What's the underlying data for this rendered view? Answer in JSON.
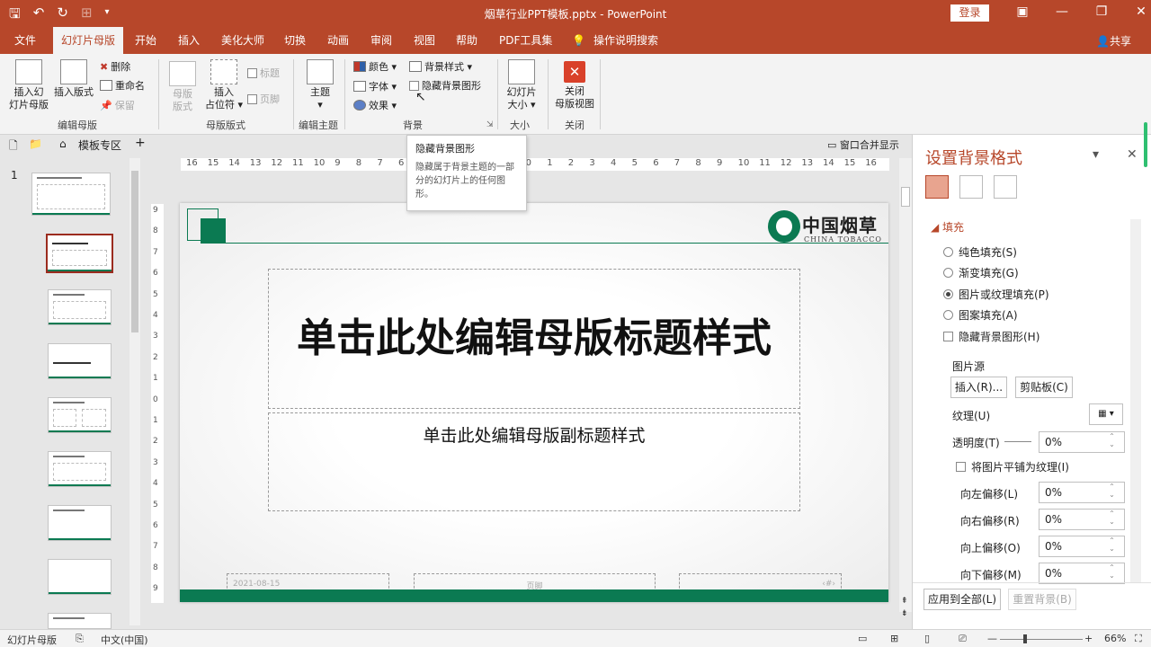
{
  "titlebar": {
    "title": "烟草行业PPT模板.pptx  -  PowerPoint",
    "login_label": "登录",
    "qat": {
      "save": "🖫",
      "undo": "↶",
      "redo": "↻",
      "touch": "⊞",
      "more": "▾"
    },
    "window": {
      "ribbon_opts": "▣",
      "minimize": "—",
      "restore": "❐",
      "close": "✕"
    }
  },
  "tabs": [
    "文件",
    "幻灯片母版",
    "开始",
    "插入",
    "美化大师",
    "切换",
    "动画",
    "审阅",
    "视图",
    "帮助",
    "PDF工具集",
    "操作说明搜索"
  ],
  "tab_share": "共享",
  "ribbon": {
    "insert_master": "插入幻\n灯片母版",
    "insert_layout": "插入版式",
    "delete": "删除",
    "rename": "重命名",
    "preserve": "保留",
    "group_edit_master": "编辑母版",
    "master_layout": "母版\n版式",
    "insert_placeholder": "插入\n占位符 ▾",
    "title_chk": "标题",
    "footer_chk": "页脚",
    "group_master_layout": "母版版式",
    "theme": "主题\n▾",
    "group_edit_theme": "编辑主题",
    "colors": "颜色 ▾",
    "fonts": "字体 ▾",
    "effects": "效果 ▾",
    "bg_styles": "背景样式 ▾",
    "hide_bg": "隐藏背景图形",
    "group_background": "背景",
    "slide_size": "幻灯片\n大小 ▾",
    "group_size": "大小",
    "close_master": "关闭\n母版视图",
    "group_close": "关闭"
  },
  "tooltip": {
    "title": "隐藏背景图形",
    "body": "隐藏属于背景主题的一部分的幻灯片上的任何图形。"
  },
  "navbar": {
    "template_area": "模板专区",
    "add": "+",
    "merge_windows": "窗口合并显示"
  },
  "thumbs": {
    "slide_number": "1"
  },
  "ruler": {
    "h": [
      "16",
      "15",
      "14",
      "13",
      "12",
      "11",
      "10",
      "9",
      "8",
      "7",
      "6",
      "5",
      "4",
      "3",
      "2",
      "1",
      "0",
      "1",
      "2",
      "3",
      "4",
      "5",
      "6",
      "7",
      "8",
      "9",
      "10",
      "11",
      "12",
      "13",
      "14",
      "15",
      "16"
    ],
    "v": [
      "9",
      "8",
      "7",
      "6",
      "5",
      "4",
      "3",
      "2",
      "1",
      "0",
      "1",
      "2",
      "3",
      "4",
      "5",
      "6",
      "7",
      "8",
      "9"
    ]
  },
  "slide": {
    "logo_cn": "中国烟草",
    "logo_en": "CHINA TOBACCO",
    "title": "单击此处编辑母版标题样式",
    "subtitle": "单击此处编辑母版副标题样式",
    "footer_date": "2021-08-15",
    "footer_text": "页脚",
    "footer_num": "‹#›"
  },
  "pane": {
    "title": "设置背景格式",
    "dropdown": "▾",
    "close": "✕",
    "section_fill": "◢ 填充",
    "fill_solid": "纯色填充(S)",
    "fill_gradient": "渐变填充(G)",
    "fill_picture": "图片或纹理填充(P)",
    "fill_pattern": "图案填充(A)",
    "hide_bg": "隐藏背景图形(H)",
    "picture_source": "图片源",
    "insert_btn": "插入(R)...",
    "clipboard_btn": "剪贴板(C)",
    "texture": "纹理(U)",
    "transparency": "透明度(T)",
    "transparency_val": "0%",
    "tile": "将图片平铺为纹理(I)",
    "offset_left": "向左偏移(L)",
    "offset_left_val": "0%",
    "offset_right": "向右偏移(R)",
    "offset_right_val": "0%",
    "offset_top": "向上偏移(O)",
    "offset_top_val": "0%",
    "offset_bottom": "向下偏移(M)",
    "offset_bottom_val": "0%",
    "apply_all": "应用到全部(L)",
    "reset_bg": "重置背景(B)"
  },
  "status": {
    "view": "幻灯片母版",
    "lang": "中文(中国)",
    "minus": "—",
    "plus": "+",
    "zoom": "66%"
  },
  "colors": {
    "accent": "#b7472a",
    "brand_green": "#0b7a52"
  }
}
